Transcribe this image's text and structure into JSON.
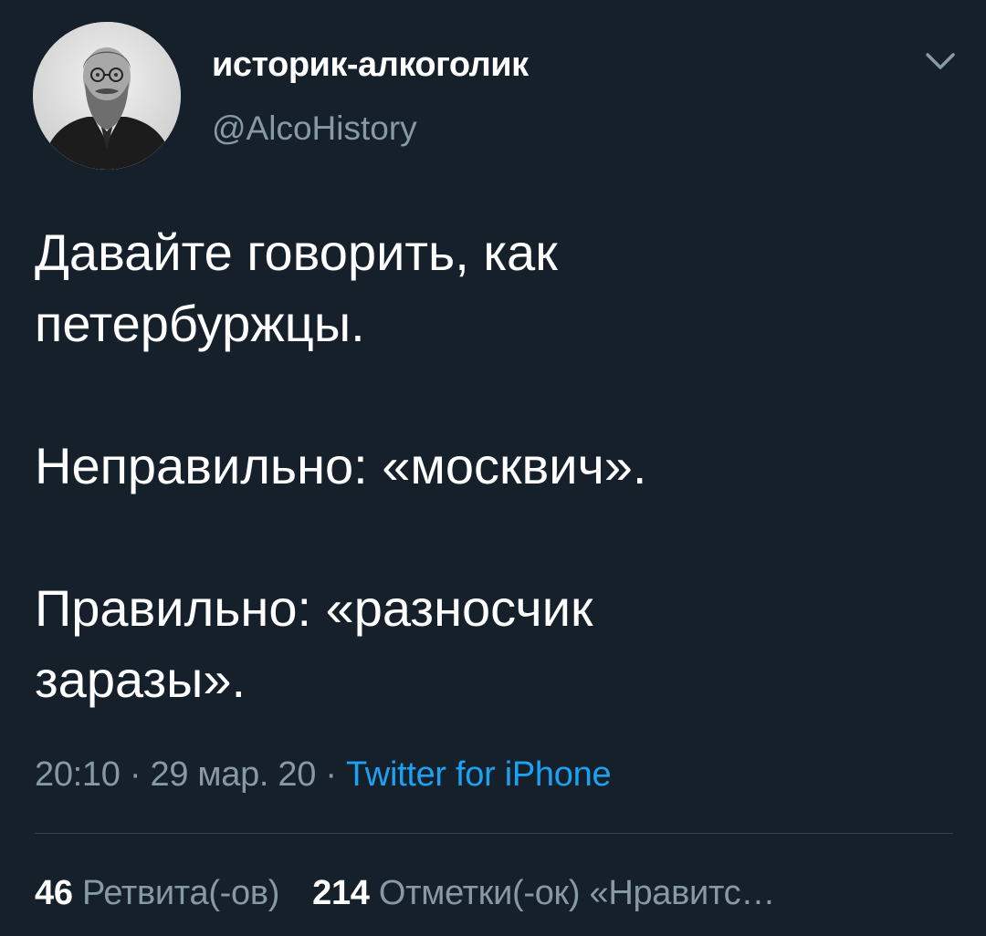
{
  "tweet": {
    "author": {
      "display_name": "историк-алкоголик",
      "handle": "@AlcoHistory",
      "avatar": "portrait-photo"
    },
    "menu_icon": "chevron-down-icon",
    "text_lines": [
      "Давайте говорить, как",
      "петербуржцы.",
      "",
      "Неправильно: «москвич».",
      "",
      "Правильно: «разносчик",
      "заразы»."
    ],
    "time": "20:10",
    "date": "29 мар. 20",
    "separator": "·",
    "source": "Twitter for iPhone",
    "stats": {
      "retweets_count": "46",
      "retweets_label": "Ретвита(-ов)",
      "likes_count": "214",
      "likes_label": "Отметки(-ок) «Нравитс…"
    }
  },
  "colors": {
    "background": "#15202b",
    "text_primary": "#ffffff",
    "text_secondary": "#8899a6",
    "link": "#1da1f2",
    "divider": "#38444d"
  }
}
